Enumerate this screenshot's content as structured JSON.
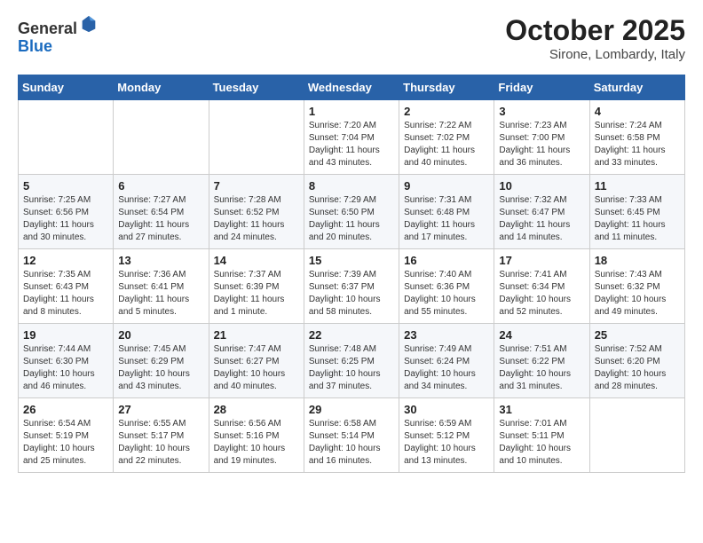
{
  "header": {
    "logo_general": "General",
    "logo_blue": "Blue",
    "title": "October 2025",
    "subtitle": "Sirone, Lombardy, Italy"
  },
  "days_of_week": [
    "Sunday",
    "Monday",
    "Tuesday",
    "Wednesday",
    "Thursday",
    "Friday",
    "Saturday"
  ],
  "weeks": [
    [
      {
        "day": "",
        "info": ""
      },
      {
        "day": "",
        "info": ""
      },
      {
        "day": "",
        "info": ""
      },
      {
        "day": "1",
        "info": "Sunrise: 7:20 AM\nSunset: 7:04 PM\nDaylight: 11 hours and 43 minutes."
      },
      {
        "day": "2",
        "info": "Sunrise: 7:22 AM\nSunset: 7:02 PM\nDaylight: 11 hours and 40 minutes."
      },
      {
        "day": "3",
        "info": "Sunrise: 7:23 AM\nSunset: 7:00 PM\nDaylight: 11 hours and 36 minutes."
      },
      {
        "day": "4",
        "info": "Sunrise: 7:24 AM\nSunset: 6:58 PM\nDaylight: 11 hours and 33 minutes."
      }
    ],
    [
      {
        "day": "5",
        "info": "Sunrise: 7:25 AM\nSunset: 6:56 PM\nDaylight: 11 hours and 30 minutes."
      },
      {
        "day": "6",
        "info": "Sunrise: 7:27 AM\nSunset: 6:54 PM\nDaylight: 11 hours and 27 minutes."
      },
      {
        "day": "7",
        "info": "Sunrise: 7:28 AM\nSunset: 6:52 PM\nDaylight: 11 hours and 24 minutes."
      },
      {
        "day": "8",
        "info": "Sunrise: 7:29 AM\nSunset: 6:50 PM\nDaylight: 11 hours and 20 minutes."
      },
      {
        "day": "9",
        "info": "Sunrise: 7:31 AM\nSunset: 6:48 PM\nDaylight: 11 hours and 17 minutes."
      },
      {
        "day": "10",
        "info": "Sunrise: 7:32 AM\nSunset: 6:47 PM\nDaylight: 11 hours and 14 minutes."
      },
      {
        "day": "11",
        "info": "Sunrise: 7:33 AM\nSunset: 6:45 PM\nDaylight: 11 hours and 11 minutes."
      }
    ],
    [
      {
        "day": "12",
        "info": "Sunrise: 7:35 AM\nSunset: 6:43 PM\nDaylight: 11 hours and 8 minutes."
      },
      {
        "day": "13",
        "info": "Sunrise: 7:36 AM\nSunset: 6:41 PM\nDaylight: 11 hours and 5 minutes."
      },
      {
        "day": "14",
        "info": "Sunrise: 7:37 AM\nSunset: 6:39 PM\nDaylight: 11 hours and 1 minute."
      },
      {
        "day": "15",
        "info": "Sunrise: 7:39 AM\nSunset: 6:37 PM\nDaylight: 10 hours and 58 minutes."
      },
      {
        "day": "16",
        "info": "Sunrise: 7:40 AM\nSunset: 6:36 PM\nDaylight: 10 hours and 55 minutes."
      },
      {
        "day": "17",
        "info": "Sunrise: 7:41 AM\nSunset: 6:34 PM\nDaylight: 10 hours and 52 minutes."
      },
      {
        "day": "18",
        "info": "Sunrise: 7:43 AM\nSunset: 6:32 PM\nDaylight: 10 hours and 49 minutes."
      }
    ],
    [
      {
        "day": "19",
        "info": "Sunrise: 7:44 AM\nSunset: 6:30 PM\nDaylight: 10 hours and 46 minutes."
      },
      {
        "day": "20",
        "info": "Sunrise: 7:45 AM\nSunset: 6:29 PM\nDaylight: 10 hours and 43 minutes."
      },
      {
        "day": "21",
        "info": "Sunrise: 7:47 AM\nSunset: 6:27 PM\nDaylight: 10 hours and 40 minutes."
      },
      {
        "day": "22",
        "info": "Sunrise: 7:48 AM\nSunset: 6:25 PM\nDaylight: 10 hours and 37 minutes."
      },
      {
        "day": "23",
        "info": "Sunrise: 7:49 AM\nSunset: 6:24 PM\nDaylight: 10 hours and 34 minutes."
      },
      {
        "day": "24",
        "info": "Sunrise: 7:51 AM\nSunset: 6:22 PM\nDaylight: 10 hours and 31 minutes."
      },
      {
        "day": "25",
        "info": "Sunrise: 7:52 AM\nSunset: 6:20 PM\nDaylight: 10 hours and 28 minutes."
      }
    ],
    [
      {
        "day": "26",
        "info": "Sunrise: 6:54 AM\nSunset: 5:19 PM\nDaylight: 10 hours and 25 minutes."
      },
      {
        "day": "27",
        "info": "Sunrise: 6:55 AM\nSunset: 5:17 PM\nDaylight: 10 hours and 22 minutes."
      },
      {
        "day": "28",
        "info": "Sunrise: 6:56 AM\nSunset: 5:16 PM\nDaylight: 10 hours and 19 minutes."
      },
      {
        "day": "29",
        "info": "Sunrise: 6:58 AM\nSunset: 5:14 PM\nDaylight: 10 hours and 16 minutes."
      },
      {
        "day": "30",
        "info": "Sunrise: 6:59 AM\nSunset: 5:12 PM\nDaylight: 10 hours and 13 minutes."
      },
      {
        "day": "31",
        "info": "Sunrise: 7:01 AM\nSunset: 5:11 PM\nDaylight: 10 hours and 10 minutes."
      },
      {
        "day": "",
        "info": ""
      }
    ]
  ]
}
